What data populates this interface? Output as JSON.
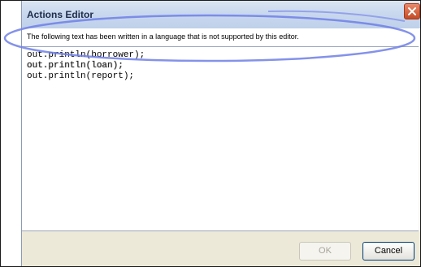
{
  "dialog": {
    "title": "Actions Editor",
    "close_icon": "close-x-icon",
    "info_message": "The following text has been written in a language that is not supported by this editor.",
    "code_lines": [
      "out.println(borrower);",
      "out.println(loan);",
      "out.println(report);"
    ],
    "buttons": {
      "ok_label": "OK",
      "cancel_label": "Cancel"
    }
  },
  "colors": {
    "annotation_ellipse": "#6f7fe6",
    "close_button": "#d45a34",
    "title_text": "#1f2d4a"
  }
}
